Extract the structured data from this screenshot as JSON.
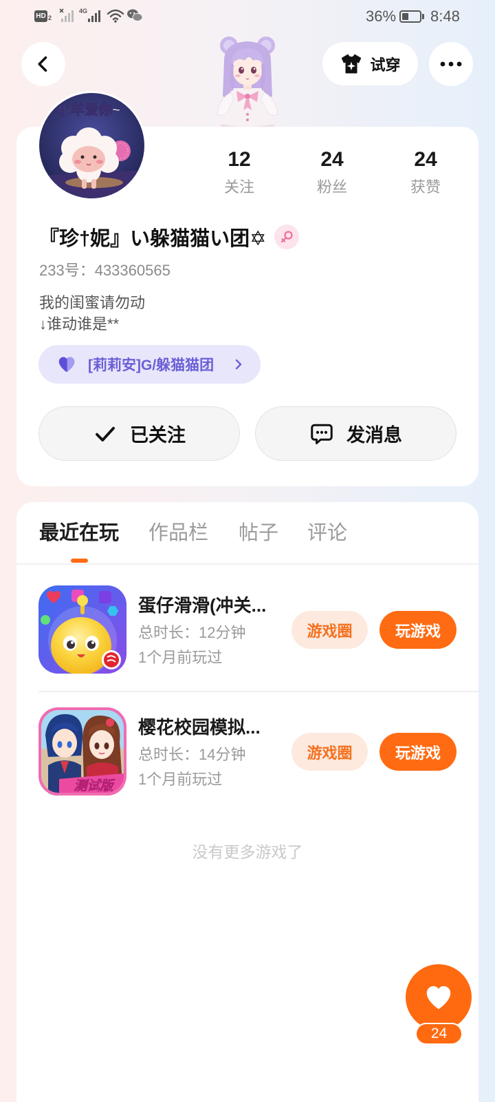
{
  "status_bar": {
    "hd": "HD",
    "sim": "2",
    "network": "4G",
    "battery_percent": "36%",
    "battery_level": 0.36,
    "time": "8:48"
  },
  "header": {
    "try_on_label": "试穿"
  },
  "profile": {
    "avatar_caption": "小羊爱你~",
    "stats": [
      {
        "value": "12",
        "label": "关注"
      },
      {
        "value": "24",
        "label": "粉丝"
      },
      {
        "value": "24",
        "label": "获赞"
      }
    ],
    "name": "『珍†妮』い躲猫猫い团✡",
    "gender": "female",
    "id_text": "233号：433360565",
    "bio": [
      "我的闺蜜请勿动",
      "↓谁动谁是**"
    ],
    "guild": "[莉莉安]G/躲猫猫团",
    "follow_label": "已关注",
    "message_label": "发消息"
  },
  "tabs": [
    {
      "label": "最近在玩",
      "active": true
    },
    {
      "label": "作品栏",
      "active": false
    },
    {
      "label": "帖子",
      "active": false
    },
    {
      "label": "评论",
      "active": false
    }
  ],
  "games": [
    {
      "title": "蛋仔滑滑(冲关...",
      "duration": "总时长：12分钟",
      "last_played": "1个月前玩过",
      "circle_label": "游戏圈",
      "play_label": "玩游戏"
    },
    {
      "title": "樱花校园模拟...",
      "icon_badge": "测试版",
      "duration": "总时长：14分钟",
      "last_played": "1个月前玩过",
      "circle_label": "游戏圈",
      "play_label": "玩游戏"
    }
  ],
  "empty_text": "没有更多游戏了",
  "like": {
    "count": "24"
  },
  "colors": {
    "accent": "#ff6a13",
    "guild_bg": "#e8e6fb",
    "guild_text": "#6a5fd6",
    "gender_pink": "#f06d9c",
    "circle_btn_bg": "#fde9de"
  },
  "icons": [
    "back-icon",
    "tshirt-icon",
    "more-icon",
    "female-icon",
    "heart-icon",
    "chevron-right-icon",
    "check-icon",
    "chat-icon",
    "signal-icon",
    "wifi-icon",
    "wechat-icon",
    "battery-icon"
  ]
}
